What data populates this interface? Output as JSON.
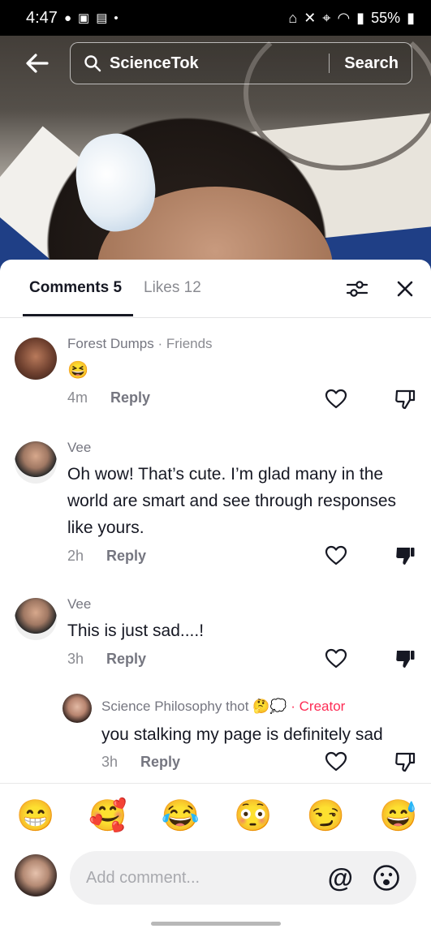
{
  "status_bar": {
    "time": "4:47",
    "battery": "55%"
  },
  "search": {
    "query": "ScienceTok",
    "button_label": "Search"
  },
  "tabs": {
    "comments_label": "Comments 5",
    "likes_label": "Likes 12"
  },
  "comments": [
    {
      "author": "Forest Dumps",
      "tag": "· Friends",
      "text": "😆",
      "time": "4m",
      "reply_label": "Reply",
      "disliked": false
    },
    {
      "author": "Vee",
      "text": "Oh wow! That’s cute. I’m glad many in the world are smart and see through responses like yours.",
      "time": "2h",
      "reply_label": "Reply",
      "disliked": true
    },
    {
      "author": "Vee",
      "text": "This is just sad....!",
      "time": "3h",
      "reply_label": "Reply",
      "disliked": true
    }
  ],
  "reply": {
    "author": "Science Philosophy thot 🤔💭",
    "creator_tag": "· Creator",
    "text": "you stalking my page is definitely sad",
    "time": "3h",
    "reply_label": "Reply",
    "disliked": false
  },
  "emoji_bar": [
    "😁",
    "🥰",
    "😂",
    "😳",
    "😏",
    "😅"
  ],
  "composer": {
    "placeholder": "Add comment...",
    "mention_symbol": "@"
  },
  "colors": {
    "accent": "#fe2c55",
    "text_primary": "#161823",
    "text_secondary": "#8a8b91"
  }
}
